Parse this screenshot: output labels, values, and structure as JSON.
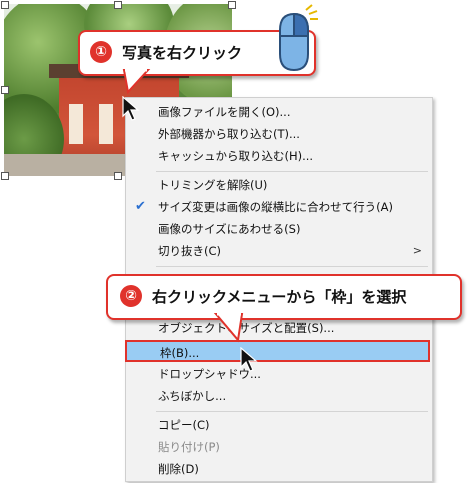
{
  "callout1": {
    "number": "①",
    "text": "写真を右クリック"
  },
  "callout2": {
    "number": "②",
    "text": "右クリックメニューから「枠」を選択"
  },
  "menu": {
    "items": [
      {
        "label": "画像ファイルを開く(O)..."
      },
      {
        "label": "外部機器から取り込む(T)..."
      },
      {
        "label": "キャッシュから取り込む(H)..."
      },
      {
        "label": "トリミングを解除(U)"
      },
      {
        "label": "サイズ変更は画像の縦横比に合わせて行う(A)",
        "checked": true
      },
      {
        "label": "画像のサイズにあわせる(S)"
      },
      {
        "label": "切り抜き(C)",
        "submenu": true
      },
      {
        "label": "オブジェクトのサイズと配置(S)..."
      },
      {
        "label": "枠(B)...",
        "highlighted": true
      },
      {
        "label": "ドロップシャドウ..."
      },
      {
        "label": "ふちぼかし..."
      },
      {
        "label": "コピー(C)"
      },
      {
        "label": "貼り付け(P)",
        "disabled": true
      },
      {
        "label": "削除(D)"
      }
    ],
    "submenu_arrow": ">",
    "check_mark": "✔"
  },
  "colors": {
    "accent_red": "#e0322b",
    "highlight_blue": "#99ccf3",
    "mouse_blue": "#7db4e6"
  },
  "icons": {
    "mouse": "mouse-icon",
    "cursor": "arrow-cursor-icon"
  }
}
